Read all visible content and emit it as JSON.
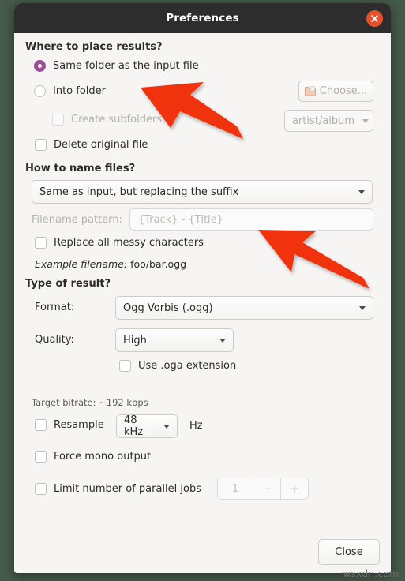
{
  "window": {
    "title": "Preferences",
    "close_icon": "close-icon"
  },
  "sections": {
    "where": {
      "heading": "Where to place results?",
      "radio_same_folder": "Same folder as the input file",
      "radio_into_folder": "Into folder",
      "choose_button": "Choose...",
      "choose_button_icon": "folder-icon",
      "create_subfolders": "Create subfolders:",
      "subfolder_pattern": "artist/album",
      "delete_original": "Delete original file"
    },
    "naming": {
      "heading": "How to name files?",
      "name_mode": "Same as input, but replacing the suffix",
      "filename_pattern_label": "Filename pattern:",
      "filename_pattern_placeholder": "{Track} - {Title}",
      "replace_messy": "Replace all messy characters",
      "example_label": "Example filename:",
      "example_value": "foo/bar.ogg"
    },
    "result": {
      "heading": "Type of result?",
      "format_label": "Format:",
      "format_value": "Ogg Vorbis (.ogg)",
      "quality_label": "Quality:",
      "quality_value": "High",
      "use_oga": "Use .oga extension",
      "target_bitrate": "Target bitrate: ~192 kbps",
      "resample": "Resample",
      "resample_rate": "48 kHz",
      "resample_unit": "Hz",
      "force_mono": "Force mono output",
      "limit_jobs": "Limit number of parallel jobs",
      "jobs_value": "1",
      "jobs_minus": "−",
      "jobs_plus": "+"
    }
  },
  "footer": {
    "close_label": "Close"
  },
  "annotations": {
    "arrow_color": "#f03010",
    "arrow_1_name": "red-arrow-pointing-to-into-folder",
    "arrow_2_name": "red-arrow-pointing-to-filename-pattern"
  },
  "watermark": "wsxdn.com",
  "colors": {
    "titlebar": "#2d2d2d",
    "close_button": "#e8502a",
    "radio_selected": "#9b4d96",
    "window_background": "#f6f5f4"
  }
}
